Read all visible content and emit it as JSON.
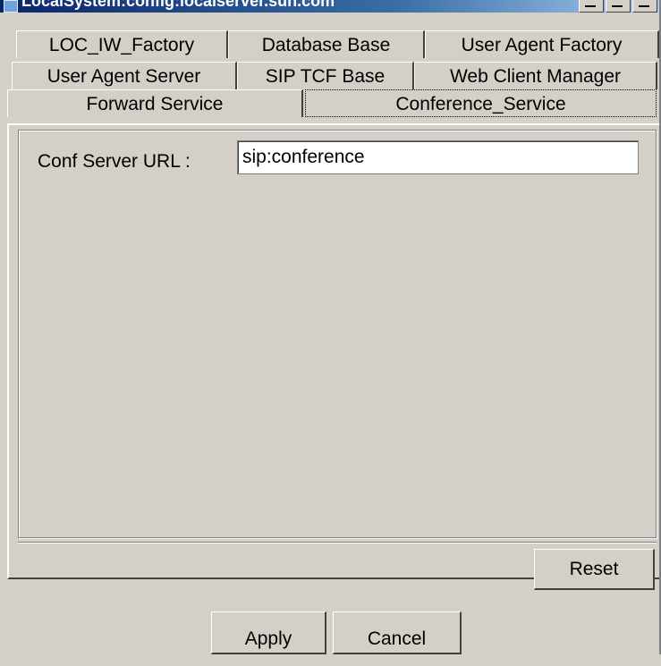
{
  "window": {
    "title": "LocalSystem:config:localserver.sun.com"
  },
  "tabs": {
    "row1": [
      "LOC_IW_Factory",
      "Database Base",
      "User Agent Factory"
    ],
    "row2": [
      "User Agent Server",
      "SIP TCF Base",
      "Web Client Manager"
    ],
    "row3": [
      "Forward Service",
      "Conference_Service"
    ],
    "active": "Conference_Service"
  },
  "form": {
    "conf_server_url_label": "Conf Server URL :",
    "conf_server_url_value": "sip:conference"
  },
  "buttons": {
    "reset": "Reset",
    "apply": "Apply",
    "cancel": "Cancel"
  },
  "colors": {
    "background": "#d4d0c8",
    "titlebar_start": "#0a246a",
    "titlebar_end": "#a6caf0"
  },
  "icons": [
    "window-icon",
    "minimize-icon",
    "maximize-icon",
    "close-icon"
  ]
}
